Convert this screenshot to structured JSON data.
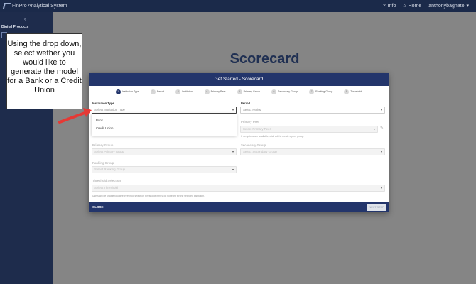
{
  "topbar": {
    "app_title": "FinPro Analytical System",
    "info_label": "Info",
    "home_label": "Home",
    "user_label": "anthonybagnato"
  },
  "sidebar": {
    "collapse_icon": "chevron-left-icon",
    "section_label": "Digital Products"
  },
  "main": {
    "page_title": "Scorecard"
  },
  "modal": {
    "title": "Get Started - Scorecard",
    "steps": [
      {
        "num": "1",
        "label": "Institution Type"
      },
      {
        "num": "2",
        "label": "Period"
      },
      {
        "num": "3",
        "label": "Institution"
      },
      {
        "num": "4",
        "label": "Primary Peer"
      },
      {
        "num": "5",
        "label": "Primary Group"
      },
      {
        "num": "6",
        "label": "Secondary Group"
      },
      {
        "num": "7",
        "label": "Ranking Group"
      },
      {
        "num": "8",
        "label": "Threshold"
      }
    ],
    "institution_type_label": "Institution Type",
    "institution_type_placeholder": "Select Institution Type",
    "institution_type_options": [
      "Bank",
      "Credit Union"
    ],
    "period_label": "Period",
    "period_placeholder": "Select Period",
    "primary_peer_label": "Primary Peer",
    "primary_peer_placeholder": "Select Primary Peer",
    "primary_peer_hint": "If no options are available, click edit to create a peer group.",
    "primary_group_label": "Primary Group",
    "primary_group_placeholder": "Select Primary Group",
    "secondary_group_label": "Secondary Group",
    "secondary_group_placeholder": "Select Secondary Group",
    "ranking_group_label": "Ranking Group",
    "ranking_group_placeholder": "Select Ranking Group",
    "threshold_label": "Threshold Selection",
    "threshold_placeholder": "Select Threshold",
    "threshold_hint": "Users will be unable to utilize threshold selection thresholds if they do not exist for the selected institution.",
    "close_label": "CLOSE",
    "next_label": "NEXT STEP"
  },
  "callout": {
    "text": "Using the drop down, select wether you would like to generate the model for a Bank or a Credit Union"
  },
  "colors": {
    "navy": "#1b2a4a",
    "modal_header": "#23356b",
    "arrow_red": "#e53935"
  }
}
